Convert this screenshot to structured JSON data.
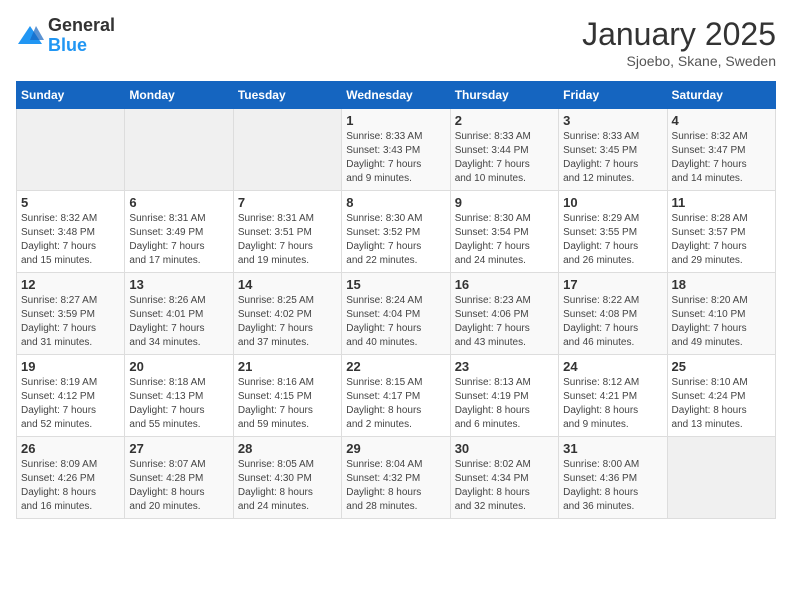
{
  "header": {
    "logo_general": "General",
    "logo_blue": "Blue",
    "month_title": "January 2025",
    "location": "Sjoebo, Skane, Sweden"
  },
  "calendar": {
    "days_of_week": [
      "Sunday",
      "Monday",
      "Tuesday",
      "Wednesday",
      "Thursday",
      "Friday",
      "Saturday"
    ],
    "weeks": [
      [
        {
          "day": "",
          "info": ""
        },
        {
          "day": "",
          "info": ""
        },
        {
          "day": "",
          "info": ""
        },
        {
          "day": "1",
          "info": "Sunrise: 8:33 AM\nSunset: 3:43 PM\nDaylight: 7 hours\nand 9 minutes."
        },
        {
          "day": "2",
          "info": "Sunrise: 8:33 AM\nSunset: 3:44 PM\nDaylight: 7 hours\nand 10 minutes."
        },
        {
          "day": "3",
          "info": "Sunrise: 8:33 AM\nSunset: 3:45 PM\nDaylight: 7 hours\nand 12 minutes."
        },
        {
          "day": "4",
          "info": "Sunrise: 8:32 AM\nSunset: 3:47 PM\nDaylight: 7 hours\nand 14 minutes."
        }
      ],
      [
        {
          "day": "5",
          "info": "Sunrise: 8:32 AM\nSunset: 3:48 PM\nDaylight: 7 hours\nand 15 minutes."
        },
        {
          "day": "6",
          "info": "Sunrise: 8:31 AM\nSunset: 3:49 PM\nDaylight: 7 hours\nand 17 minutes."
        },
        {
          "day": "7",
          "info": "Sunrise: 8:31 AM\nSunset: 3:51 PM\nDaylight: 7 hours\nand 19 minutes."
        },
        {
          "day": "8",
          "info": "Sunrise: 8:30 AM\nSunset: 3:52 PM\nDaylight: 7 hours\nand 22 minutes."
        },
        {
          "day": "9",
          "info": "Sunrise: 8:30 AM\nSunset: 3:54 PM\nDaylight: 7 hours\nand 24 minutes."
        },
        {
          "day": "10",
          "info": "Sunrise: 8:29 AM\nSunset: 3:55 PM\nDaylight: 7 hours\nand 26 minutes."
        },
        {
          "day": "11",
          "info": "Sunrise: 8:28 AM\nSunset: 3:57 PM\nDaylight: 7 hours\nand 29 minutes."
        }
      ],
      [
        {
          "day": "12",
          "info": "Sunrise: 8:27 AM\nSunset: 3:59 PM\nDaylight: 7 hours\nand 31 minutes."
        },
        {
          "day": "13",
          "info": "Sunrise: 8:26 AM\nSunset: 4:01 PM\nDaylight: 7 hours\nand 34 minutes."
        },
        {
          "day": "14",
          "info": "Sunrise: 8:25 AM\nSunset: 4:02 PM\nDaylight: 7 hours\nand 37 minutes."
        },
        {
          "day": "15",
          "info": "Sunrise: 8:24 AM\nSunset: 4:04 PM\nDaylight: 7 hours\nand 40 minutes."
        },
        {
          "day": "16",
          "info": "Sunrise: 8:23 AM\nSunset: 4:06 PM\nDaylight: 7 hours\nand 43 minutes."
        },
        {
          "day": "17",
          "info": "Sunrise: 8:22 AM\nSunset: 4:08 PM\nDaylight: 7 hours\nand 46 minutes."
        },
        {
          "day": "18",
          "info": "Sunrise: 8:20 AM\nSunset: 4:10 PM\nDaylight: 7 hours\nand 49 minutes."
        }
      ],
      [
        {
          "day": "19",
          "info": "Sunrise: 8:19 AM\nSunset: 4:12 PM\nDaylight: 7 hours\nand 52 minutes."
        },
        {
          "day": "20",
          "info": "Sunrise: 8:18 AM\nSunset: 4:13 PM\nDaylight: 7 hours\nand 55 minutes."
        },
        {
          "day": "21",
          "info": "Sunrise: 8:16 AM\nSunset: 4:15 PM\nDaylight: 7 hours\nand 59 minutes."
        },
        {
          "day": "22",
          "info": "Sunrise: 8:15 AM\nSunset: 4:17 PM\nDaylight: 8 hours\nand 2 minutes."
        },
        {
          "day": "23",
          "info": "Sunrise: 8:13 AM\nSunset: 4:19 PM\nDaylight: 8 hours\nand 6 minutes."
        },
        {
          "day": "24",
          "info": "Sunrise: 8:12 AM\nSunset: 4:21 PM\nDaylight: 8 hours\nand 9 minutes."
        },
        {
          "day": "25",
          "info": "Sunrise: 8:10 AM\nSunset: 4:24 PM\nDaylight: 8 hours\nand 13 minutes."
        }
      ],
      [
        {
          "day": "26",
          "info": "Sunrise: 8:09 AM\nSunset: 4:26 PM\nDaylight: 8 hours\nand 16 minutes."
        },
        {
          "day": "27",
          "info": "Sunrise: 8:07 AM\nSunset: 4:28 PM\nDaylight: 8 hours\nand 20 minutes."
        },
        {
          "day": "28",
          "info": "Sunrise: 8:05 AM\nSunset: 4:30 PM\nDaylight: 8 hours\nand 24 minutes."
        },
        {
          "day": "29",
          "info": "Sunrise: 8:04 AM\nSunset: 4:32 PM\nDaylight: 8 hours\nand 28 minutes."
        },
        {
          "day": "30",
          "info": "Sunrise: 8:02 AM\nSunset: 4:34 PM\nDaylight: 8 hours\nand 32 minutes."
        },
        {
          "day": "31",
          "info": "Sunrise: 8:00 AM\nSunset: 4:36 PM\nDaylight: 8 hours\nand 36 minutes."
        },
        {
          "day": "",
          "info": ""
        }
      ]
    ]
  }
}
